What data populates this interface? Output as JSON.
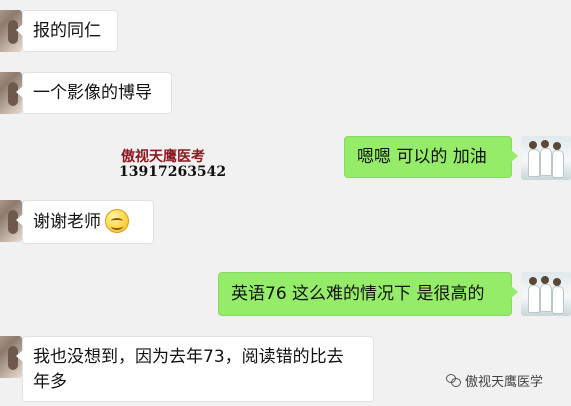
{
  "messages": [
    {
      "side": "left",
      "text": "报的同仁"
    },
    {
      "side": "left",
      "text": "一个影像的博导"
    },
    {
      "side": "right",
      "text": "嗯嗯 可以的 加油"
    },
    {
      "side": "left",
      "text": "谢谢老师",
      "emoji": "smile-emoji"
    },
    {
      "side": "right",
      "text": "英语76 这么难的情况下 是很高的"
    },
    {
      "side": "left",
      "line1": "我也没想到，因为去年73，阅读错的比去",
      "line2": "年多"
    }
  ],
  "watermark": {
    "title": "傲视天鹰医考",
    "phone": "13917263542"
  },
  "brand": {
    "icon": "wechat-icon",
    "label": "傲视天鹰医学"
  },
  "colors": {
    "background": "#f1f1f1",
    "left_bubble": "#ffffff",
    "right_bubble": "#95ec69",
    "watermark_title": "#8b1a20"
  }
}
